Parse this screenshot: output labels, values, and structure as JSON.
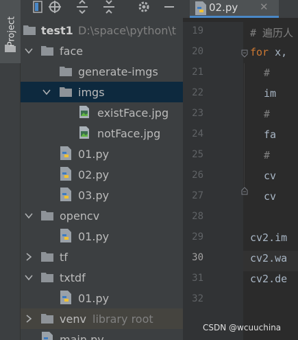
{
  "sidebar": {
    "project_tab_label": "Project"
  },
  "toolbar": {
    "icons": [
      "window-layout-icon",
      "crosshair-icon",
      "expand-all-icon",
      "collapse-all-icon",
      "gear-icon",
      "hide-icon"
    ]
  },
  "tree": {
    "root_name": "test1",
    "root_path": "D:\\space\\python\\t",
    "items": [
      {
        "label": "face"
      },
      {
        "label": "generate-imgs"
      },
      {
        "label": "imgs"
      },
      {
        "label": "existFace.jpg"
      },
      {
        "label": "notFace.jpg"
      },
      {
        "label": "01.py"
      },
      {
        "label": "02.py"
      },
      {
        "label": "03.py"
      },
      {
        "label": "opencv"
      },
      {
        "label": "01.py"
      },
      {
        "label": "tf"
      },
      {
        "label": "txtdf"
      },
      {
        "label": "01.py"
      },
      {
        "label": "venv",
        "note": "library root"
      },
      {
        "label": "main.py"
      }
    ]
  },
  "editor": {
    "tab_label": "02.py",
    "tab_close": "✕",
    "line_numbers": [
      "19",
      "20",
      "21",
      "22",
      "23",
      "24",
      "25",
      "26",
      "27",
      "28",
      "29",
      "30",
      "31",
      "32"
    ],
    "current_line": "30",
    "lines": [
      "# 遍历人",
      "for x,",
      "#",
      "im",
      "#",
      "fa",
      "#",
      "cv",
      "cv",
      "",
      "cv2.im",
      "cv2.wa",
      "cv2.de",
      ""
    ]
  },
  "watermark": "CSDN @wcuuchina",
  "colors": {
    "panel_bg": "#3c3f41",
    "editor_bg": "#2b2b2b",
    "selection": "#0d293e",
    "keyword": "#cc7832",
    "comment": "#808080"
  }
}
